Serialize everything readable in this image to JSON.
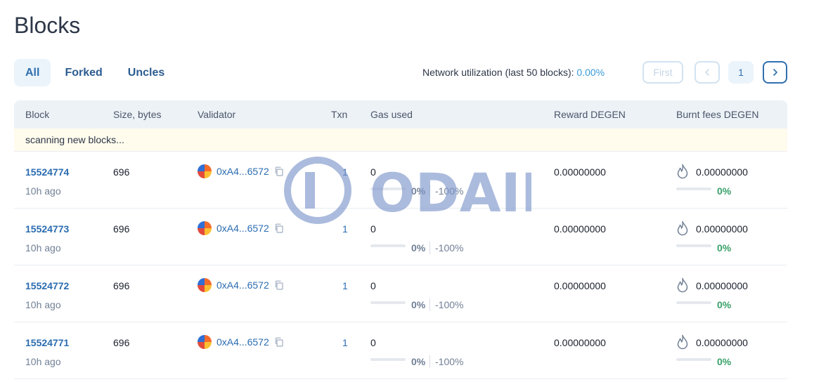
{
  "page": {
    "title": "Blocks"
  },
  "tabs": [
    {
      "label": "All",
      "active": true
    },
    {
      "label": "Forked",
      "active": false
    },
    {
      "label": "Uncles",
      "active": false
    }
  ],
  "network_utilization": {
    "label": "Network utilization (last 50 blocks): ",
    "value": "0.00%"
  },
  "pagination": {
    "first_label": "First",
    "current_page": "1"
  },
  "table": {
    "headers": [
      "Block",
      "Size, bytes",
      "Validator",
      "Txn",
      "Gas used",
      "Reward DEGEN",
      "Burnt fees DEGEN"
    ],
    "scanning_text": "scanning new blocks...",
    "rows": [
      {
        "block": "15524774",
        "age": "10h ago",
        "size": "696",
        "validator": "0xA4...6572",
        "txn": "1",
        "gas_used": "0",
        "gas_pct": "0%",
        "gas_delta": "-100%",
        "reward": "0.00000000",
        "burnt_fees": "0.00000000",
        "burnt_pct": "0%"
      },
      {
        "block": "15524773",
        "age": "10h ago",
        "size": "696",
        "validator": "0xA4...6572",
        "txn": "1",
        "gas_used": "0",
        "gas_pct": "0%",
        "gas_delta": "-100%",
        "reward": "0.00000000",
        "burnt_fees": "0.00000000",
        "burnt_pct": "0%"
      },
      {
        "block": "15524772",
        "age": "10h ago",
        "size": "696",
        "validator": "0xA4...6572",
        "txn": "1",
        "gas_used": "0",
        "gas_pct": "0%",
        "gas_delta": "-100%",
        "reward": "0.00000000",
        "burnt_fees": "0.00000000",
        "burnt_pct": "0%"
      },
      {
        "block": "15524771",
        "age": "10h ago",
        "size": "696",
        "validator": "0xA4...6572",
        "txn": "1",
        "gas_used": "0",
        "gas_pct": "0%",
        "gas_delta": "-100%",
        "reward": "0.00000000",
        "burnt_fees": "0.00000000",
        "burnt_pct": "0%"
      }
    ]
  },
  "watermark": {
    "text": "ODAILY"
  },
  "colors": {
    "link": "#2b6cb0",
    "accent": "#3a9ad9",
    "positive": "#38a169",
    "scan_bg": "#fffbed",
    "header_bg": "#edf2f7",
    "watermark": "#7f97cc"
  },
  "icons": [
    "copy-icon",
    "flame-icon",
    "chevron-left-icon",
    "chevron-right-icon",
    "validator-avatar"
  ]
}
